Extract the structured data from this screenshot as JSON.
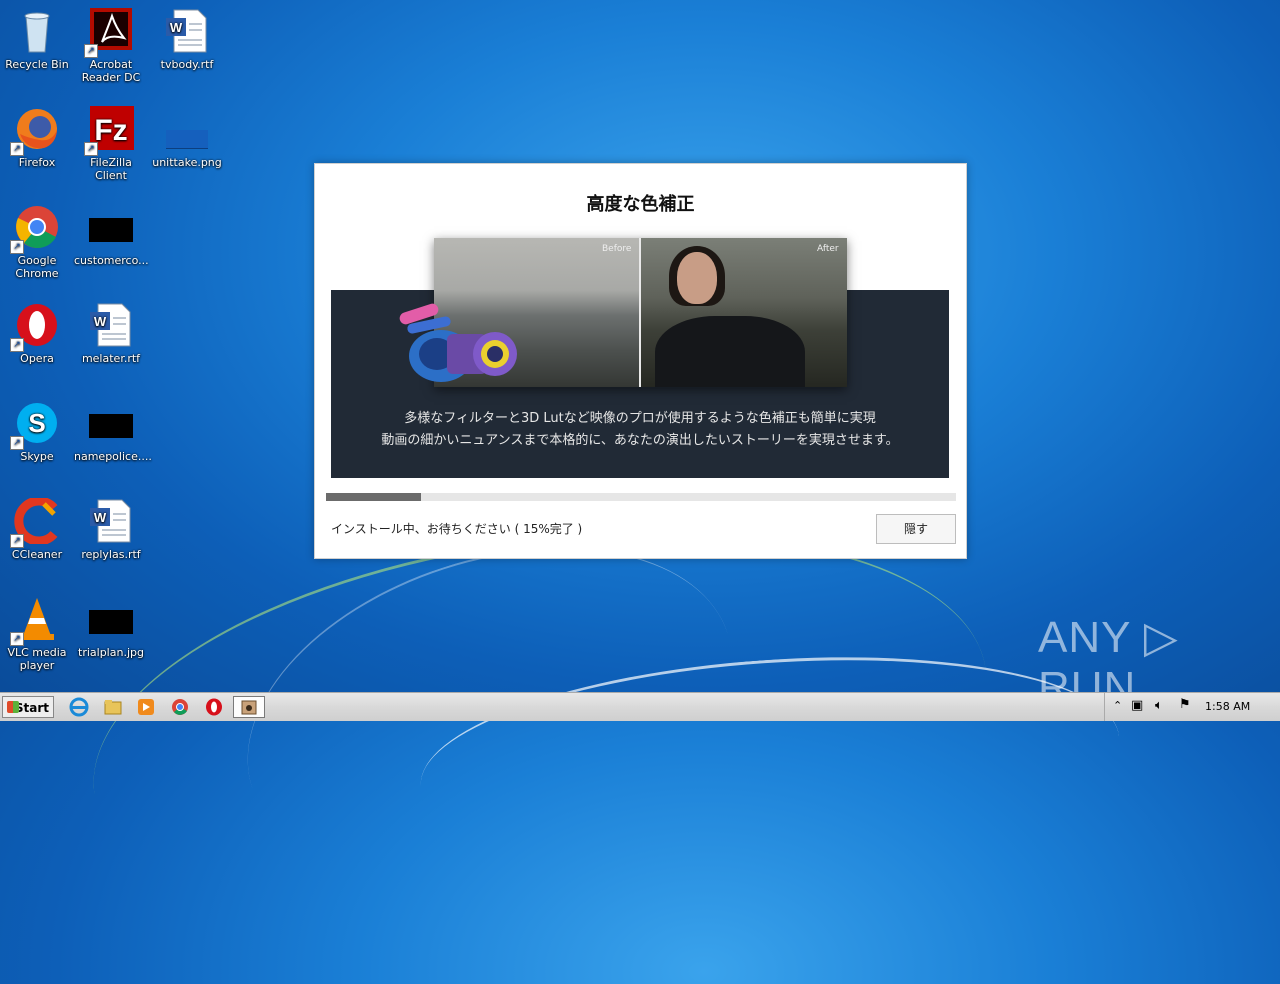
{
  "desktop": {
    "icons": [
      {
        "label": "Recycle Bin"
      },
      {
        "label": "Acrobat Reader DC"
      },
      {
        "label": "tvbody.rtf"
      },
      {
        "label": "Firefox"
      },
      {
        "label": "FileZilla Client"
      },
      {
        "label": "unittake.png"
      },
      {
        "label": "Google Chrome"
      },
      {
        "label": "customerco..."
      },
      {
        "label": "Opera"
      },
      {
        "label": "melater.rtf"
      },
      {
        "label": "Skype"
      },
      {
        "label": "namepolice...."
      },
      {
        "label": "CCleaner"
      },
      {
        "label": "replylas.rtf"
      },
      {
        "label": "VLC media player"
      },
      {
        "label": "trialplan.jpg"
      }
    ]
  },
  "installer": {
    "title": "高度な色補正",
    "before_label": "Before",
    "after_label": "After",
    "description_line1": "多様なフィルターと3D Lutなど映像のプロが使用するような色補正も簡単に実現",
    "description_line2": "動画の細かいニュアンスまで本格的に、あなたの演出したいストーリーを実現させます。",
    "progress_percent": 15,
    "status_text": "インストール中、お待ちください ( 15%完了 )",
    "hide_button": "隠す"
  },
  "watermark": "ANY ▷ RUN",
  "taskbar": {
    "start_label": "Start",
    "clock": "1:58 AM"
  }
}
